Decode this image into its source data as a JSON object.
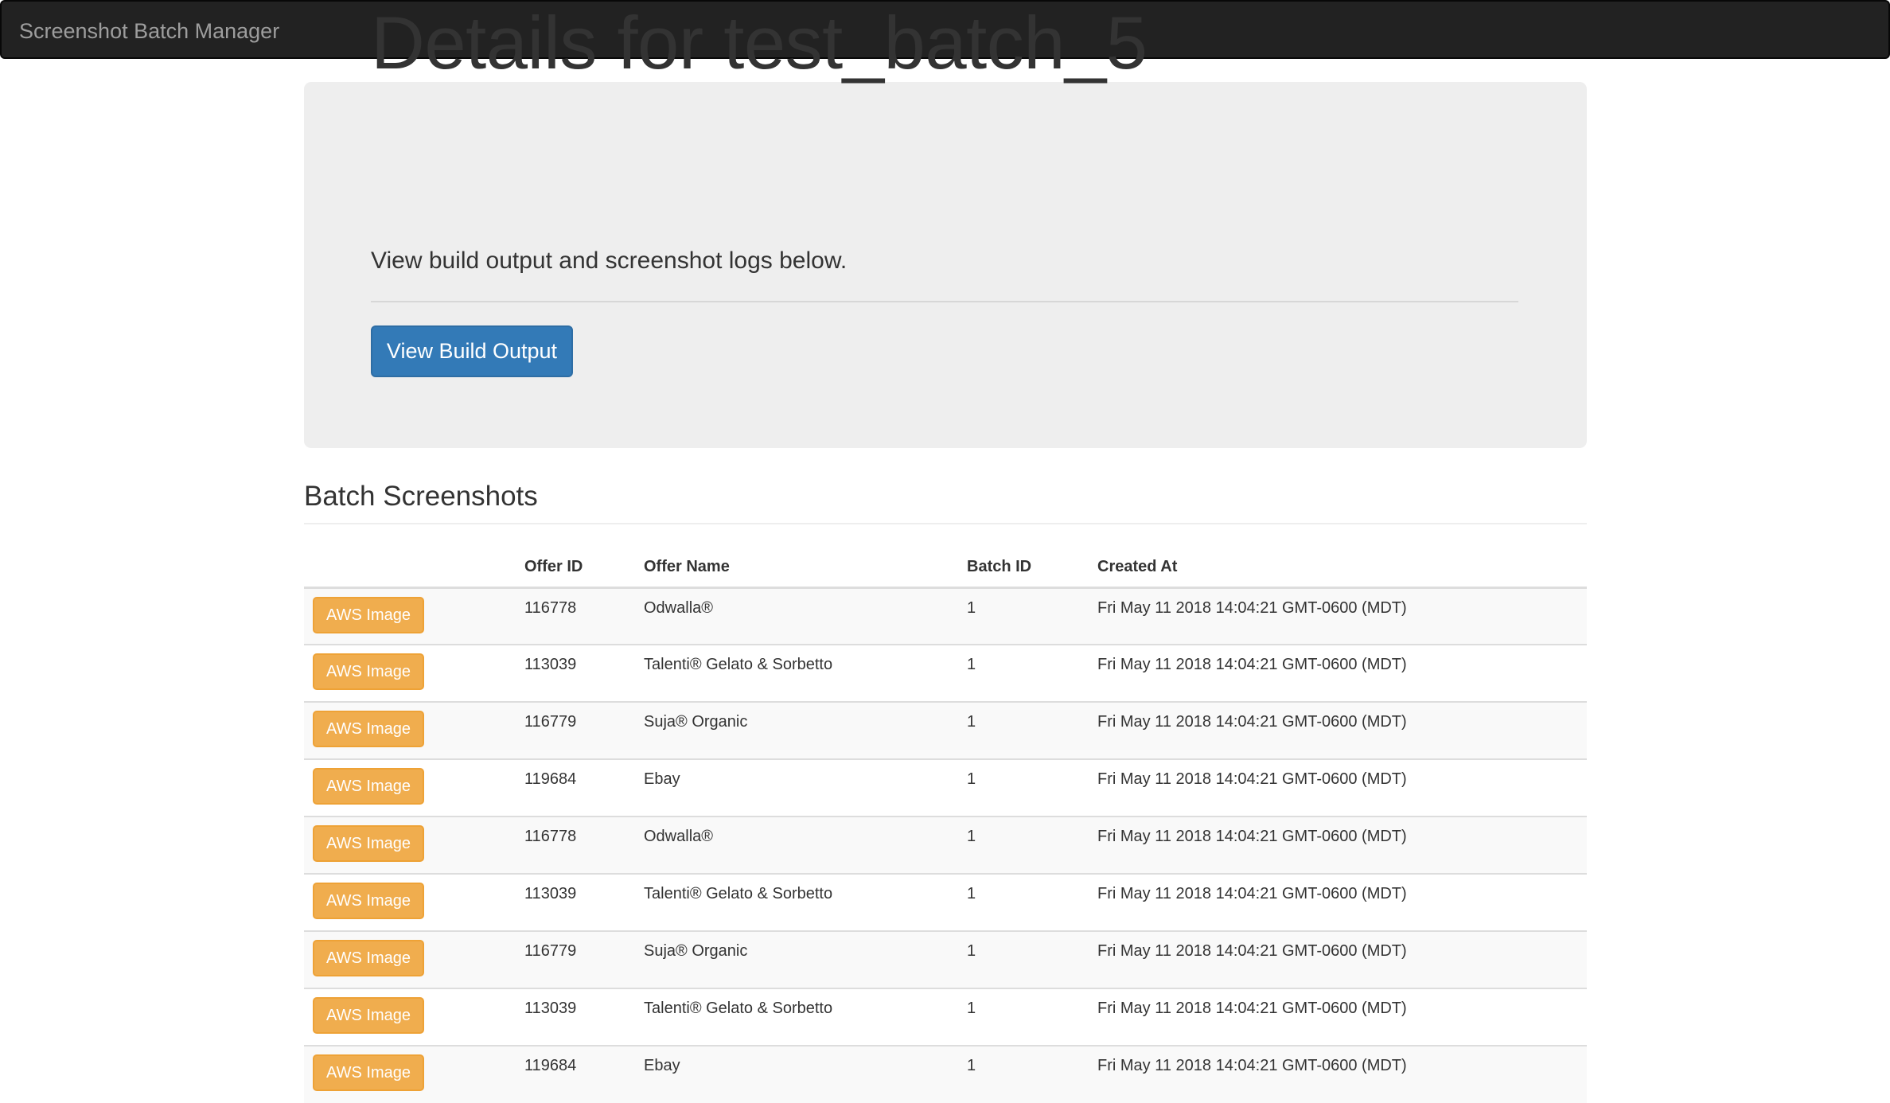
{
  "navbar": {
    "brand": "Screenshot Batch Manager"
  },
  "jumbotron": {
    "title": "Details for test_batch_5",
    "lead": "View build output and screenshot logs below.",
    "button_label": "View Build Output"
  },
  "section": {
    "title": "Batch Screenshots"
  },
  "table": {
    "headers": [
      "",
      "Offer ID",
      "Offer Name",
      "Batch ID",
      "Created At"
    ],
    "rows": [
      {
        "action": "AWS Image",
        "offer_id": "116778",
        "offer_name": "Odwalla®",
        "batch_id": "1",
        "created_at": "Fri May 11 2018 14:04:21 GMT-0600 (MDT)"
      },
      {
        "action": "AWS Image",
        "offer_id": "113039",
        "offer_name": "Talenti® Gelato & Sorbetto",
        "batch_id": "1",
        "created_at": "Fri May 11 2018 14:04:21 GMT-0600 (MDT)"
      },
      {
        "action": "AWS Image",
        "offer_id": "116779",
        "offer_name": "Suja® Organic",
        "batch_id": "1",
        "created_at": "Fri May 11 2018 14:04:21 GMT-0600 (MDT)"
      },
      {
        "action": "AWS Image",
        "offer_id": "119684",
        "offer_name": "Ebay",
        "batch_id": "1",
        "created_at": "Fri May 11 2018 14:04:21 GMT-0600 (MDT)"
      },
      {
        "action": "AWS Image",
        "offer_id": "116778",
        "offer_name": "Odwalla®",
        "batch_id": "1",
        "created_at": "Fri May 11 2018 14:04:21 GMT-0600 (MDT)"
      },
      {
        "action": "AWS Image",
        "offer_id": "113039",
        "offer_name": "Talenti® Gelato & Sorbetto",
        "batch_id": "1",
        "created_at": "Fri May 11 2018 14:04:21 GMT-0600 (MDT)"
      },
      {
        "action": "AWS Image",
        "offer_id": "116779",
        "offer_name": "Suja® Organic",
        "batch_id": "1",
        "created_at": "Fri May 11 2018 14:04:21 GMT-0600 (MDT)"
      },
      {
        "action": "AWS Image",
        "offer_id": "113039",
        "offer_name": "Talenti® Gelato & Sorbetto",
        "batch_id": "1",
        "created_at": "Fri May 11 2018 14:04:21 GMT-0600 (MDT)"
      },
      {
        "action": "AWS Image",
        "offer_id": "119684",
        "offer_name": "Ebay",
        "batch_id": "1",
        "created_at": "Fri May 11 2018 14:04:21 GMT-0600 (MDT)"
      }
    ]
  },
  "colors": {
    "navbar_bg": "#222222",
    "primary": "#337ab7",
    "warning": "#f0ad4e",
    "jumbotron_bg": "#eeeeee"
  }
}
